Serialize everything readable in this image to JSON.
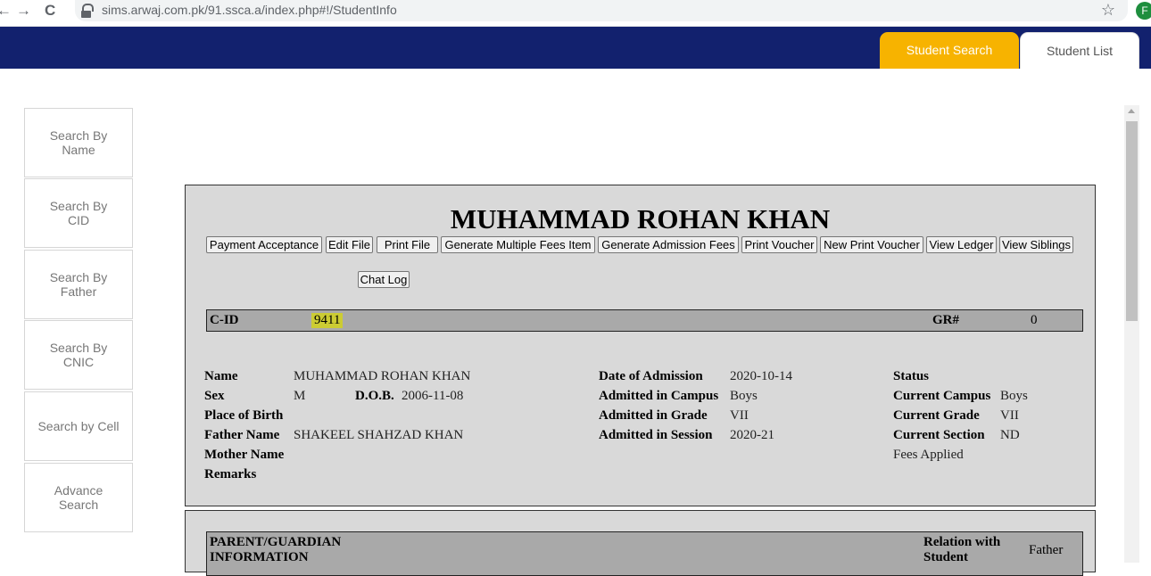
{
  "browser": {
    "url": "sims.arwaj.com.pk/91.ssca.a/index.php#!/StudentInfo",
    "back_icon": "←",
    "forward_icon": "→",
    "reload_icon": "C",
    "star_icon": "☆",
    "profile_initial": "F"
  },
  "header": {
    "tabs": [
      "Student Search",
      "Student List"
    ],
    "active_color": "#f7b300",
    "bar_color": "#12216e"
  },
  "sidebar": {
    "items": [
      "Search By Name",
      "Search By CID",
      "Search By Father",
      "Search By CNIC",
      "Search by Cell",
      "Advance Search"
    ]
  },
  "student": {
    "name_title": "MUHAMMAD ROHAN KHAN",
    "actions": [
      "Payment Acceptance",
      "Edit File",
      "Print File",
      "Generate Multiple Fees Item",
      "Generate Admission Fees",
      "Print Voucher",
      "New Print Voucher",
      "View Ledger",
      "View Siblings",
      "Chat Log"
    ],
    "cid_label": "C-ID",
    "cid_value": "9411",
    "gr_label": "GR#",
    "gr_value": "0",
    "labels": {
      "name": "Name",
      "sex": "Sex",
      "dob": "D.O.B.",
      "place_of_birth": "Place of Birth",
      "father_name": "Father Name",
      "mother_name": "Mother Name",
      "remarks": "Remarks",
      "date_of_admission": "Date of Admission",
      "admitted_campus": "Admitted in Campus",
      "admitted_grade": "Admitted in Grade",
      "admitted_session": "Admitted in Session",
      "status": "Status",
      "current_campus": "Current Campus",
      "current_grade": "Current Grade",
      "current_section": "Current Section"
    },
    "values": {
      "name": "MUHAMMAD ROHAN KHAN",
      "sex": "M",
      "dob": "2006-11-08",
      "father_name": "SHAKEEL SHAHZAD KHAN",
      "date_of_admission": "2020-10-14",
      "admitted_campus": "Boys",
      "admitted_grade": "VII",
      "admitted_session": "2020-21",
      "current_campus": "Boys",
      "current_grade": "VII",
      "current_section": "ND",
      "fees_applied": "Fees Applied"
    }
  },
  "guardian": {
    "heading_line1": "PARENT/GUARDIAN",
    "heading_line2": "INFORMATION",
    "relation_line1": "Relation with",
    "relation_line2": "Student",
    "relation_value": "Father"
  }
}
